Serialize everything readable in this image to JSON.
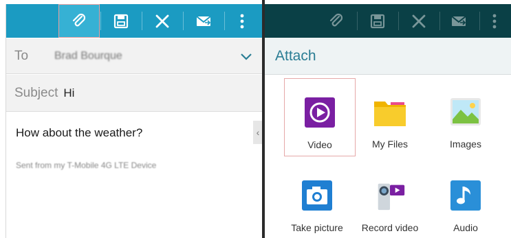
{
  "compose": {
    "to_label": "To",
    "to_value": "Brad Bourque",
    "subject_label": "Subject",
    "subject_value": "Hi",
    "body_text": "How about the weather?",
    "signature": "Sent from my T-Mobile 4G LTE Device"
  },
  "toolbar": {
    "icons": [
      "paperclip-icon",
      "save-icon",
      "close-icon",
      "send-icon",
      "more-icon"
    ]
  },
  "attach": {
    "title": "Attach",
    "items": [
      {
        "label": "Video",
        "icon": "video-icon"
      },
      {
        "label": "My Files",
        "icon": "folder-icon"
      },
      {
        "label": "Images",
        "icon": "image-icon"
      },
      {
        "label": "Take picture",
        "icon": "camera-icon"
      },
      {
        "label": "Record video",
        "icon": "camcorder-icon"
      },
      {
        "label": "Audio",
        "icon": "music-note-icon"
      }
    ]
  },
  "colors": {
    "toolbar_active": "#1b9bc2",
    "toolbar_dimmed": "#0a4046",
    "accent_title": "#2a7d94",
    "video_tile": "#7a1fa2",
    "folder": "#f5c518",
    "audio_tile": "#2a8fd8"
  }
}
